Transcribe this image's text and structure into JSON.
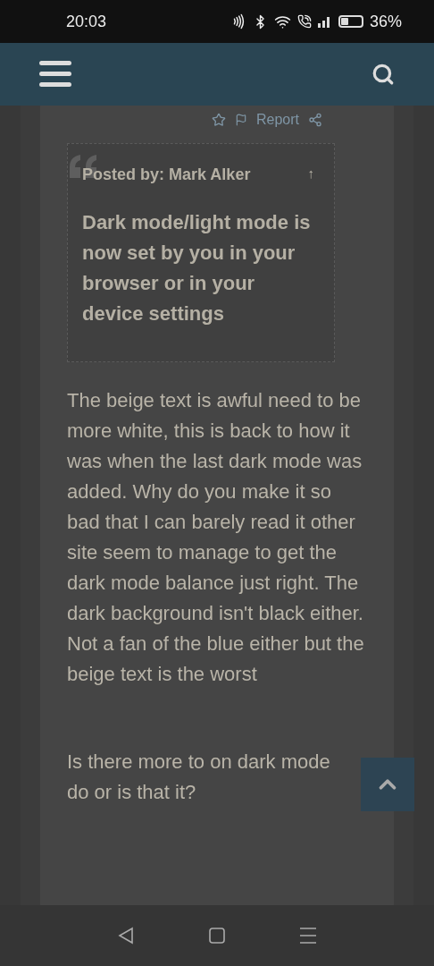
{
  "status_bar": {
    "time": "20:03",
    "battery": "36%"
  },
  "post_actions": {
    "report": "Report"
  },
  "quote": {
    "author": "Posted by: Mark Alker",
    "arrow": "↑",
    "text": "Dark mode/light mode is now set by you in your browser or in your device settings"
  },
  "paragraphs": [
    "The beige text is awful need to be more white, this is back to how it was when the last dark mode was added. Why do you make it so bad that I can barely read it other site seem to manage to get the dark mode balance just right. The dark background isn't black either.  Not a fan of the blue either but the beige text is the worst",
    "Is there more to on dark mode do or is that it?"
  ]
}
